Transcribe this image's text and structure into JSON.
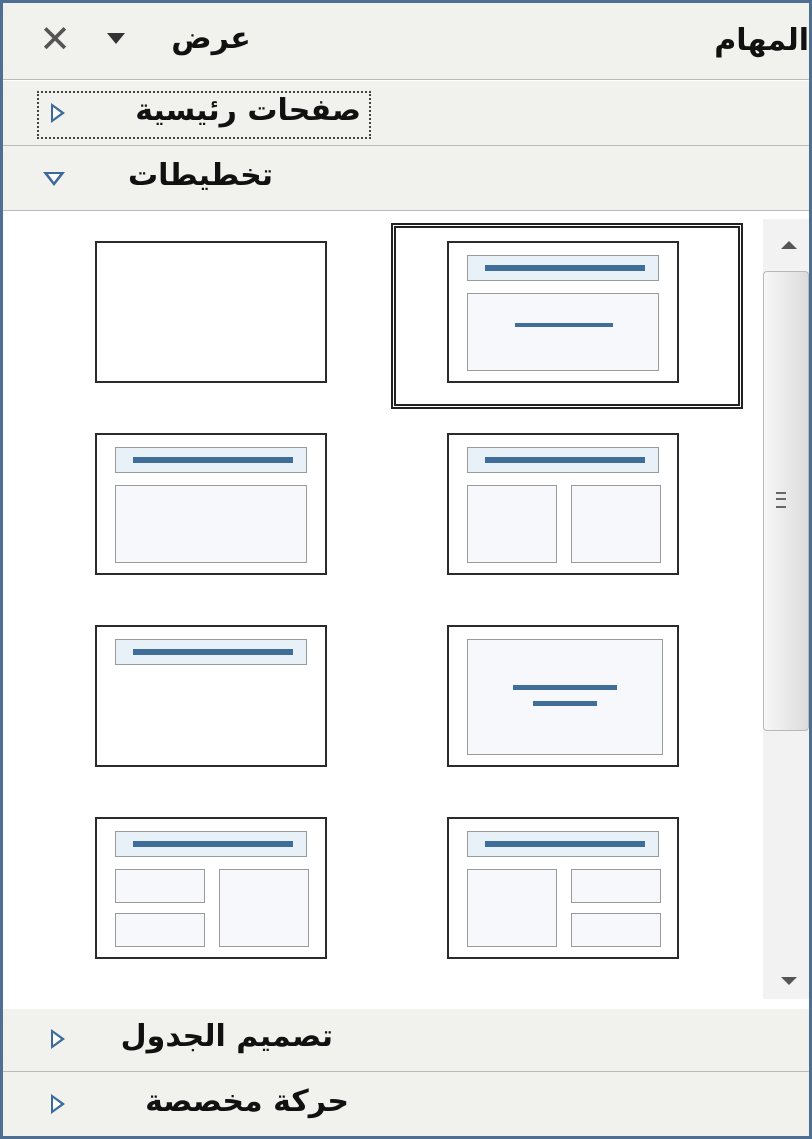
{
  "panel": {
    "title": "المهام",
    "view_label": "عرض",
    "dropdown_icon": "chevron-down-icon",
    "close_icon": "close-icon"
  },
  "sections": {
    "master_pages": {
      "label": "صفحات رئيسية",
      "expanded": false
    },
    "layouts": {
      "label": "تخطيطات",
      "expanded": true
    },
    "table_design": {
      "label": "تصميم الجدول",
      "expanded": false
    },
    "custom_animation": {
      "label": "حركة مخصصة",
      "expanded": false
    }
  },
  "layouts": {
    "selected_index": 1,
    "items": [
      "blank-slide",
      "title-content",
      "title-content",
      "title-two-content",
      "title-only",
      "centered-text",
      "title-content-two-content",
      "title-two-content-content"
    ]
  },
  "colors": {
    "border": "#4f6f92",
    "header_bg": "#f1f1ee",
    "accent_line": "#3f6f98",
    "arrow": "#3c6a9a"
  }
}
